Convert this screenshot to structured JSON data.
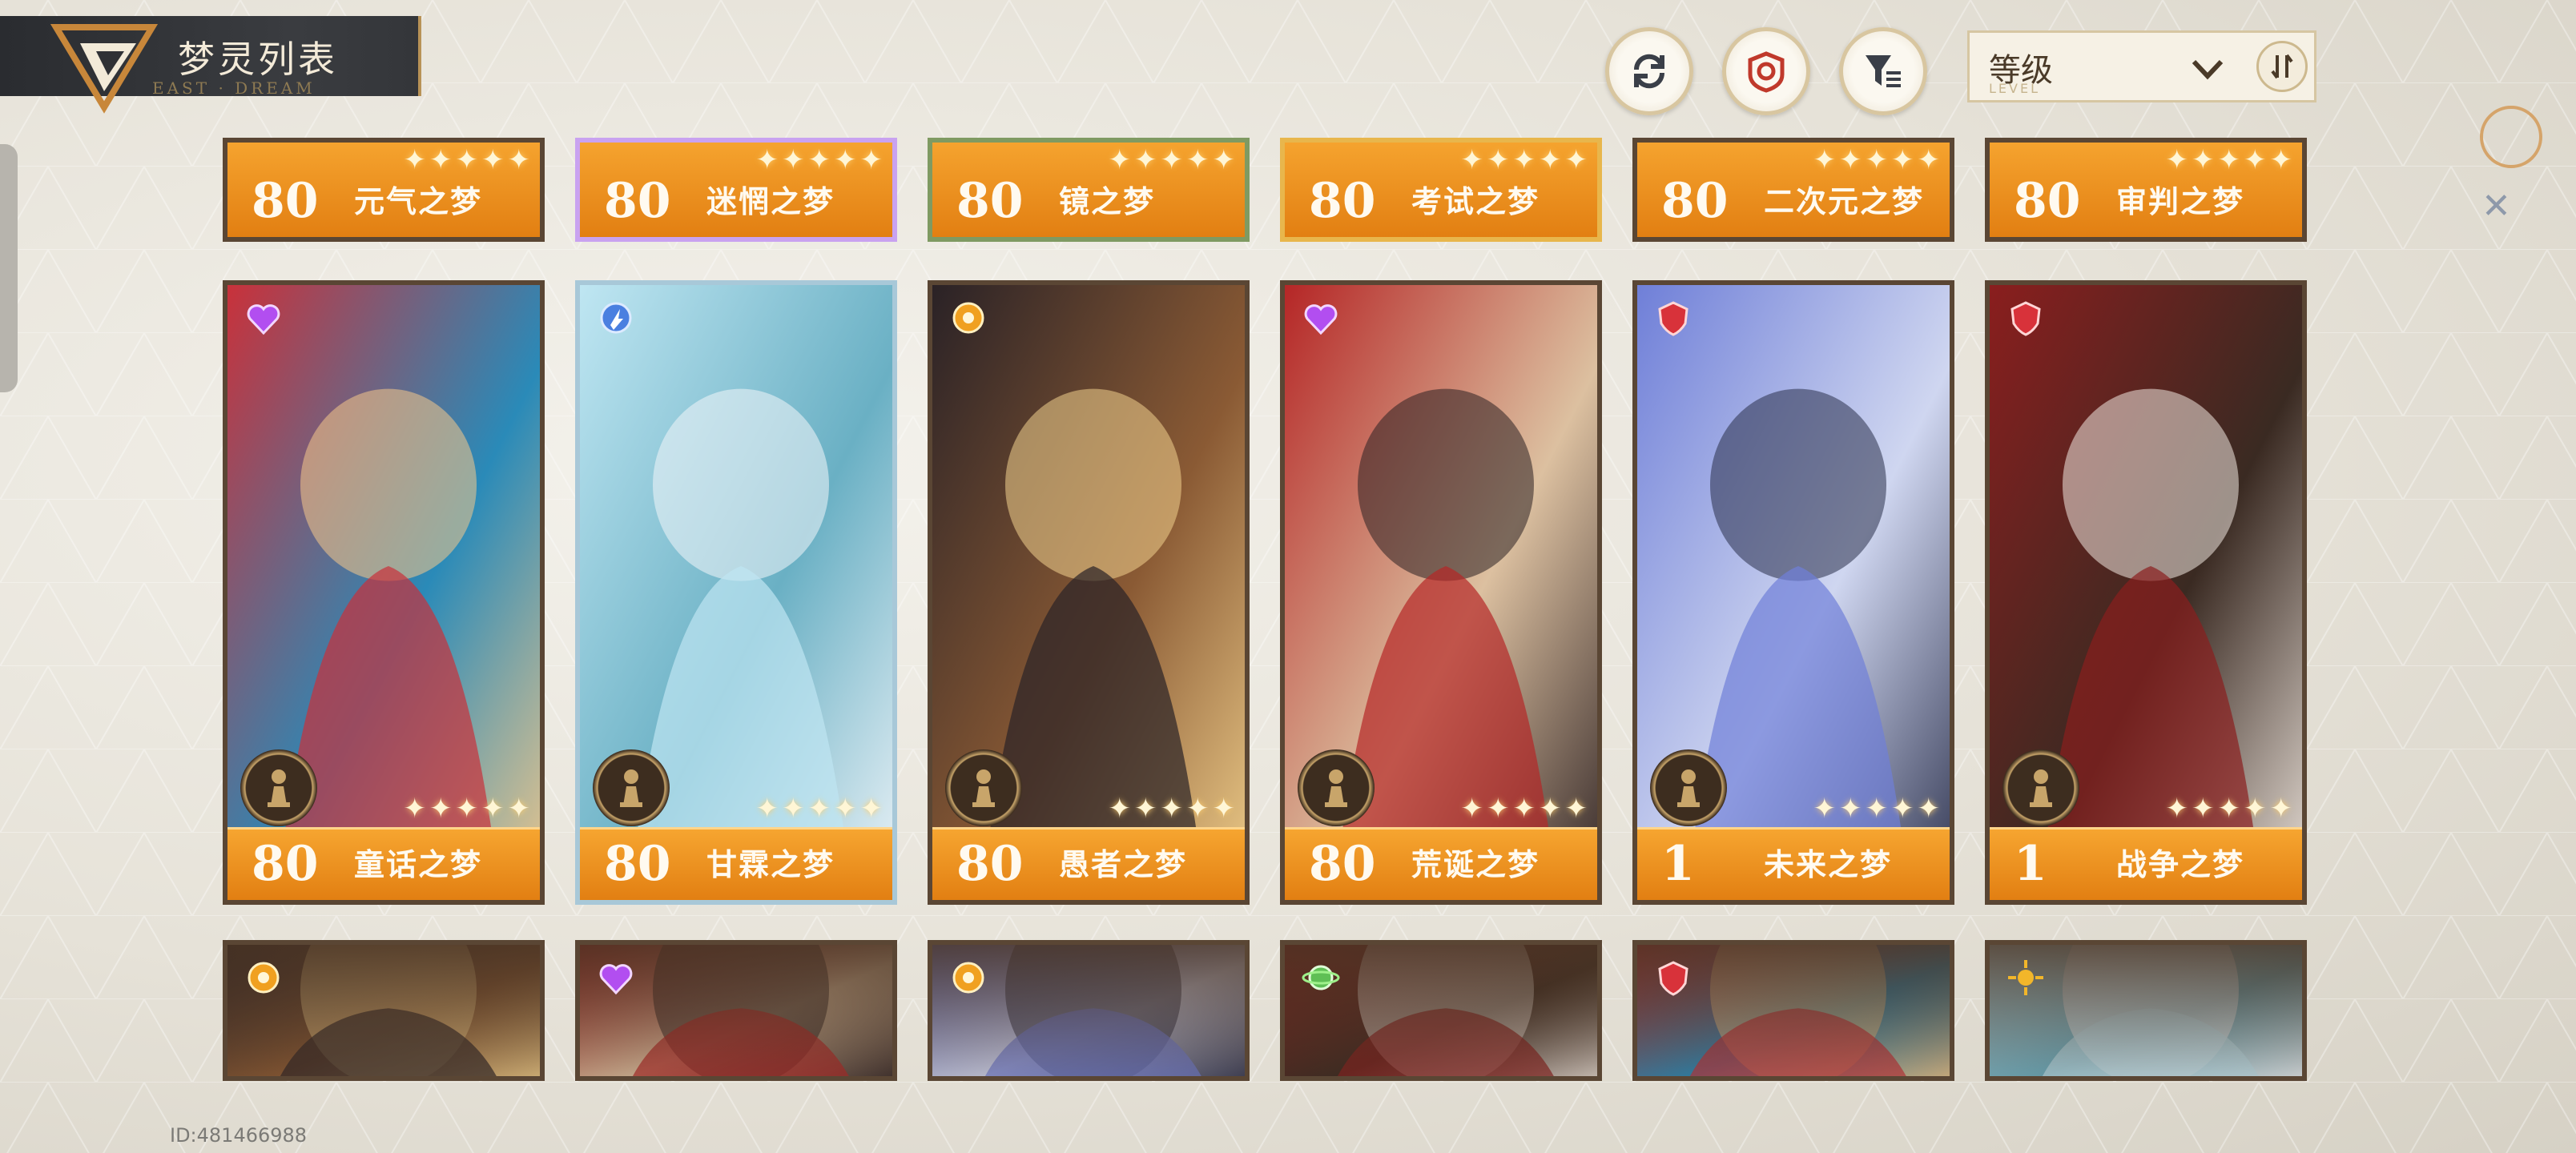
{
  "header": {
    "title": "梦灵列表",
    "sort_label": "等级"
  },
  "icons": {
    "refresh": "refresh-icon",
    "target": "target-icon",
    "filter": "filter-icon",
    "sort_order": "sort-order-icon"
  },
  "colors": {
    "card_orange": "#f0951f",
    "header_dark": "#2f3135",
    "accent_gold": "#c9a060"
  },
  "top_row": [
    {
      "level": "80",
      "name": "元气之梦",
      "frame": "default"
    },
    {
      "level": "80",
      "name": "迷惘之梦",
      "frame": "purple"
    },
    {
      "level": "80",
      "name": "镜之梦",
      "frame": "green"
    },
    {
      "level": "80",
      "name": "考试之梦",
      "frame": "gold"
    },
    {
      "level": "80",
      "name": "二次元之梦",
      "frame": "default"
    },
    {
      "level": "80",
      "name": "审判之梦",
      "frame": "default"
    }
  ],
  "main_row": [
    {
      "level": "80",
      "name": "童话之梦",
      "element": "heart-purple-icon",
      "frame": "default",
      "stars": "✦✦✦✦✦"
    },
    {
      "level": "80",
      "name": "甘霖之梦",
      "element": "spark-blue-icon",
      "frame": "blue",
      "stars": "✦✦✦✦✦"
    },
    {
      "level": "80",
      "name": "愚者之梦",
      "element": "orb-gold-icon",
      "frame": "default",
      "stars": "✦✦✦✦✦"
    },
    {
      "level": "80",
      "name": "荒诞之梦",
      "element": "heart-purple-icon",
      "frame": "default",
      "stars": "✦✦✦✦✦"
    },
    {
      "level": "1",
      "name": "未来之梦",
      "element": "shield-red-icon",
      "frame": "default",
      "stars": "✦✦✦✦✦"
    },
    {
      "level": "1",
      "name": "战争之梦",
      "element": "shield-red-icon",
      "frame": "default",
      "stars": "✦✦✦✦✦"
    }
  ],
  "bottom_row": [
    {
      "element": "orb-gold-icon"
    },
    {
      "element": "heart-purple-icon"
    },
    {
      "element": "orb-gold-icon"
    },
    {
      "element": "planet-green-icon"
    },
    {
      "element": "shield-red-icon"
    },
    {
      "element": "sun-gold-icon"
    }
  ],
  "footer": {
    "player_id": "ID:481466988"
  }
}
